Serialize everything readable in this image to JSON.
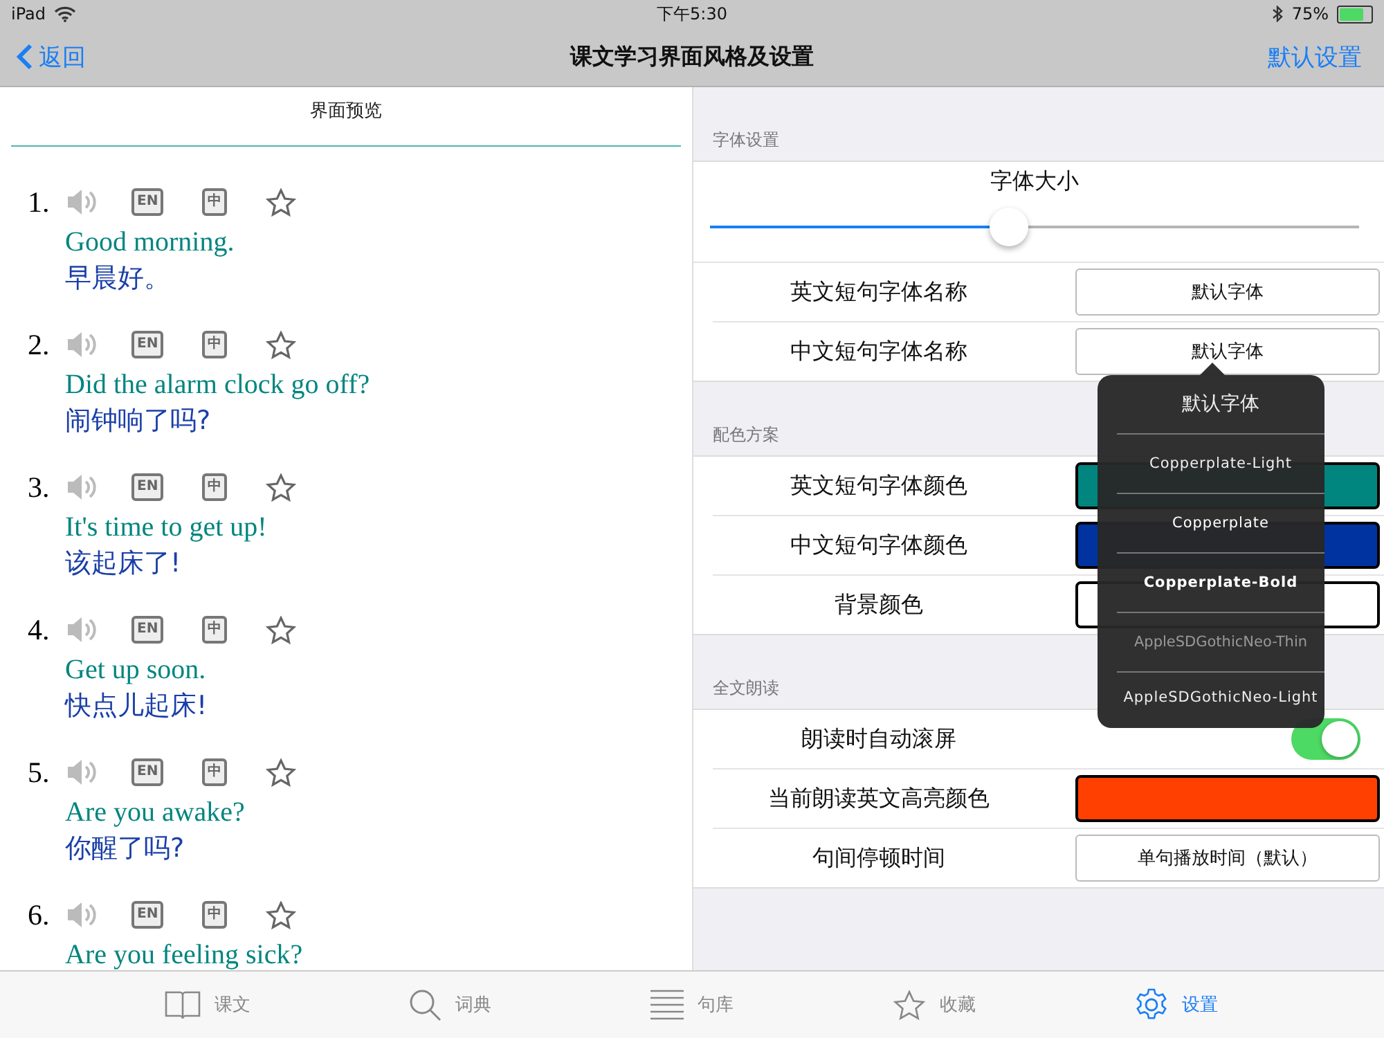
{
  "status_bar": {
    "device": "iPad",
    "time": "下午5:30",
    "battery_text": "75%",
    "battery": {
      "level": 0.75
    }
  },
  "nav": {
    "back": "返回",
    "title": "课文学习界面风格及设置",
    "action": "默认设置"
  },
  "preview": {
    "title": "界面预览",
    "sentences": [
      {
        "number": "1.",
        "en_key": "EN",
        "zh_key": "中",
        "english": "Good morning.",
        "chinese": "早晨好。"
      },
      {
        "number": "2.",
        "en_key": "EN",
        "zh_key": "中",
        "english": "Did the alarm clock go off?",
        "chinese": "闹钟响了吗?"
      },
      {
        "number": "3.",
        "en_key": "EN",
        "zh_key": "中",
        "english": "It's time to get up!",
        "chinese": "该起床了!"
      },
      {
        "number": "4.",
        "en_key": "EN",
        "zh_key": "中",
        "english": "Get up soon.",
        "chinese": "快点儿起床!"
      },
      {
        "number": "5.",
        "en_key": "EN",
        "zh_key": "中",
        "english": "Are you awake?",
        "chinese": "你醒了吗?"
      },
      {
        "number": "6.",
        "en_key": "EN",
        "zh_key": "中",
        "english": "Are you feeling sick?"
      }
    ]
  },
  "settings": [
    {
      "header": "字体设置",
      "rows": [
        {
          "kind": "slider",
          "label": "字体大小",
          "level": 0.46
        },
        {
          "kind": "select",
          "label": "英文短句字体名称",
          "value": "默认字体"
        },
        {
          "kind": "select",
          "label": "中文短句字体名称",
          "value": "默认字体"
        }
      ]
    },
    {
      "header": "配色方案",
      "rows": [
        {
          "kind": "color",
          "label": "英文短句字体颜色",
          "color": "#00857f"
        },
        {
          "kind": "color",
          "label": "中文短句字体颜色",
          "color": "#0033a0"
        },
        {
          "kind": "color",
          "label": "背景颜色",
          "color": "#ffffff"
        }
      ]
    },
    {
      "header": "全文朗读",
      "rows": [
        {
          "kind": "toggle",
          "label": "朗读时自动滚屏",
          "on": true
        },
        {
          "kind": "color",
          "label": "当前朗读英文高亮颜色",
          "color": "#ff4000"
        },
        {
          "kind": "select",
          "label": "句间停顿时间",
          "value": "单句播放时间（默认）"
        }
      ]
    }
  ],
  "font_popup": {
    "items": [
      {
        "label": "默认字体",
        "kind": "cjk"
      },
      {
        "label": "Copperplate-Light",
        "kind": "light"
      },
      {
        "label": "Copperplate",
        "kind": "regular"
      },
      {
        "label": "Copperplate-Bold",
        "kind": "bold"
      },
      {
        "label": "AppleSDGothicNeo-Thin",
        "kind": "thin"
      },
      {
        "label": "AppleSDGothicNeo-Light",
        "kind": "light"
      }
    ]
  },
  "tabs": [
    {
      "label": "课文",
      "selected": false
    },
    {
      "label": "词典",
      "selected": false
    },
    {
      "label": "句库",
      "selected": false
    },
    {
      "label": "收藏",
      "selected": false
    },
    {
      "label": "设置",
      "selected": true
    }
  ]
}
